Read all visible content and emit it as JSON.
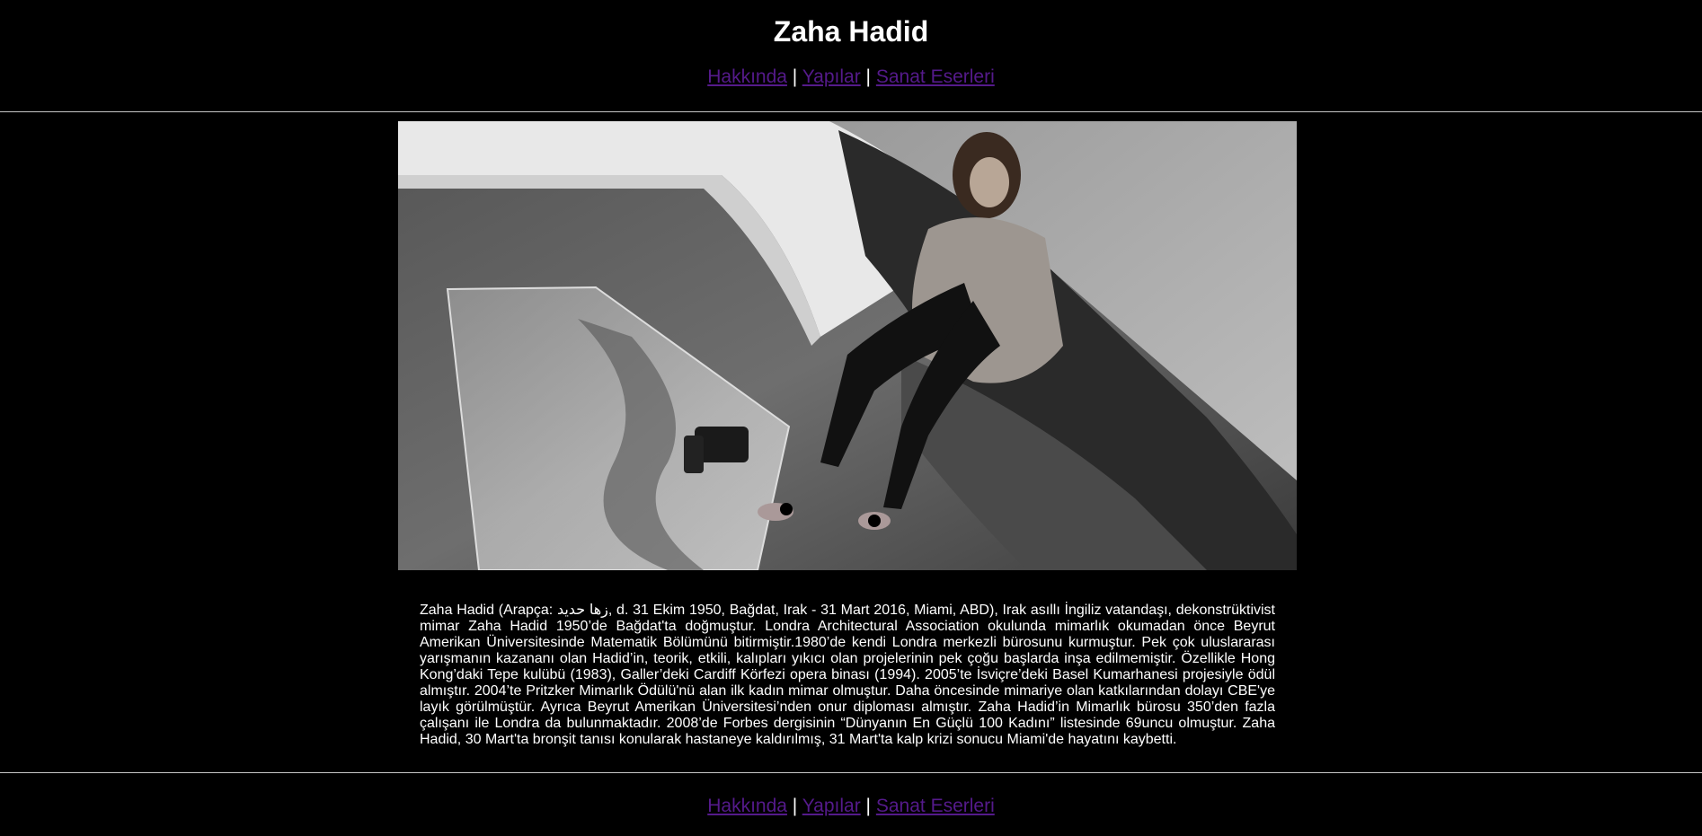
{
  "page": {
    "title": "Zaha Hadid"
  },
  "nav": {
    "items": [
      {
        "label": "Hakkında"
      },
      {
        "label": "Yapılar"
      },
      {
        "label": "Sanat Eserleri"
      }
    ],
    "separator": "|"
  },
  "photo": {
    "subject": "black-and-white portrait photo"
  },
  "bio": {
    "text": "Zaha Hadid (Arapça: زها حديد, d. 31 Ekim 1950, Bağdat, Irak - 31 Mart 2016, Miami, ABD), Irak asıllı İngiliz vatandaşı, dekonstrüktivist mimar Zaha Hadid 1950’de Bağdat'ta doğmuştur. Londra Architectural Association okulunda mimarlık okumadan önce Beyrut Amerikan Üniversitesinde Matematik Bölümünü bitirmiştir.1980’de kendi Londra merkezli bürosunu kurmuştur. Pek çok uluslararası yarışmanın kazananı olan Hadid’in, teorik, etkili, kalıpları yıkıcı olan projelerinin pek çoğu başlarda inşa edilmemiştir. Özellikle Hong Kong’daki Tepe kulübü (1983), Galler’deki Cardiff Körfezi opera binası (1994). 2005’te İsviçre’deki Basel Kumarhanesi projesiyle ödül almıştır. 2004’te Pritzker Mimarlık Ödülü'nü alan ilk kadın mimar olmuştur. Daha öncesinde mimariye olan katkılarından dolayı CBE'ye layık görülmüştür. Ayrıca Beyrut Amerikan Üniversitesi’nden onur diploması almıştır. Zaha Hadid’in Mimarlık bürosu 350’den fazla çalışanı ile Londra da bulunmaktadır. 2008’de Forbes dergisinin “Dünyanın En Güçlü 100 Kadını” listesinde 69uncu olmuştur. Zaha Hadid, 30 Mart'ta bronşit tanısı konularak hastaneye kaldırılmış, 31 Mart'ta kalp krizi sonucu Miami'de hayatını kaybetti."
  },
  "colors": {
    "background": "#000000",
    "text": "#ffffff",
    "link_visited": "#551a8b",
    "rule": "#c8c8c8"
  }
}
